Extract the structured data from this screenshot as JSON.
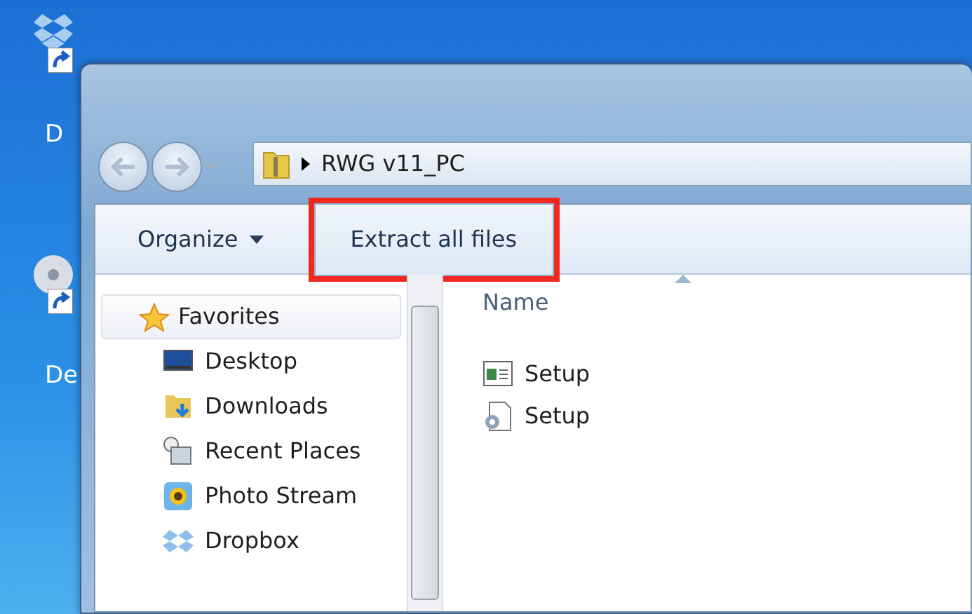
{
  "desktop_icons": [
    {
      "label": "D",
      "kind": "dropbox"
    },
    {
      "label": "De",
      "kind": "disc"
    }
  ],
  "window": {
    "address": {
      "path": "RWG v11_PC"
    },
    "toolbar": [
      {
        "label": "Organize",
        "kind": "menu",
        "highlighted": false
      },
      {
        "label": "Extract all files",
        "kind": "button",
        "highlighted": true
      }
    ],
    "nav": {
      "header": "Favorites",
      "items": [
        {
          "label": "Desktop",
          "kind": "desktop"
        },
        {
          "label": "Downloads",
          "kind": "downloads"
        },
        {
          "label": "Recent Places",
          "kind": "recent"
        },
        {
          "label": "Photo Stream",
          "kind": "photo"
        },
        {
          "label": "Dropbox",
          "kind": "dropbox"
        }
      ]
    },
    "columns": [
      "Name"
    ],
    "files": [
      {
        "name": "Setup",
        "kind": "app"
      },
      {
        "name": "Setup",
        "kind": "config"
      }
    ]
  }
}
